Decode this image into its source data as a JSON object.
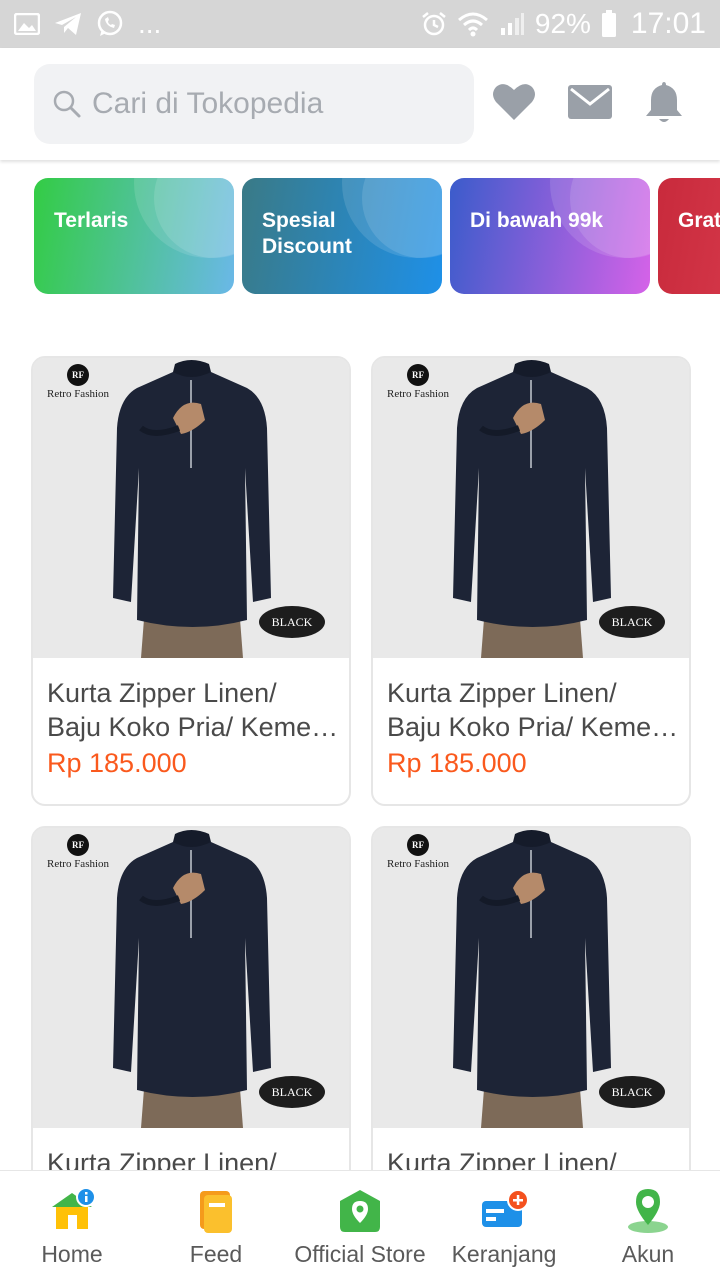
{
  "status_bar": {
    "battery": "92%",
    "time": "17:01",
    "overflow": "..."
  },
  "search": {
    "placeholder": "Cari di Tokopedia"
  },
  "header_icons": [
    "heart-icon",
    "mail-icon",
    "bell-icon"
  ],
  "categories": [
    {
      "label": "Terlaris",
      "colors": [
        "#33cc44",
        "#6ab8e8"
      ]
    },
    {
      "label": "Spesial Discount",
      "colors": [
        "#3a7a86",
        "#1e90e8"
      ]
    },
    {
      "label": "Di bawah 99k",
      "colors": [
        "#3b5ccb",
        "#d562e8"
      ]
    },
    {
      "label": "Grat",
      "colors": [
        "#c82a3c",
        "#e34658"
      ]
    }
  ],
  "products": [
    {
      "name_line1": "Kurta Zipper Linen/",
      "name_line2": "Baju Koko Pria/ Keme…",
      "price": "Rp 185.000",
      "brand": "Retro Fashion",
      "tag": "BLACK"
    },
    {
      "name_line1": "Kurta Zipper Linen/",
      "name_line2": "Baju Koko Pria/ Keme…",
      "price": "Rp 185.000",
      "brand": "Retro Fashion",
      "tag": "BLACK"
    },
    {
      "name_line1": "Kurta Zipper Linen/",
      "name_line2": "",
      "price": "",
      "brand": "Retro Fashion",
      "tag": "BLACK"
    },
    {
      "name_line1": "Kurta Zipper Linen/",
      "name_line2": "",
      "price": "",
      "brand": "Retro Fashion",
      "tag": "BLACK"
    }
  ],
  "bottom_nav": [
    {
      "label": "Home",
      "icon": "home-icon"
    },
    {
      "label": "Feed",
      "icon": "feed-icon"
    },
    {
      "label": "Official Store",
      "icon": "official-store-icon"
    },
    {
      "label": "Keranjang",
      "icon": "cart-icon"
    },
    {
      "label": "Akun",
      "icon": "account-icon"
    }
  ],
  "colors": {
    "price": "#fa591d",
    "brand_green": "#42b549",
    "status_bar": "#d6d6d6"
  }
}
